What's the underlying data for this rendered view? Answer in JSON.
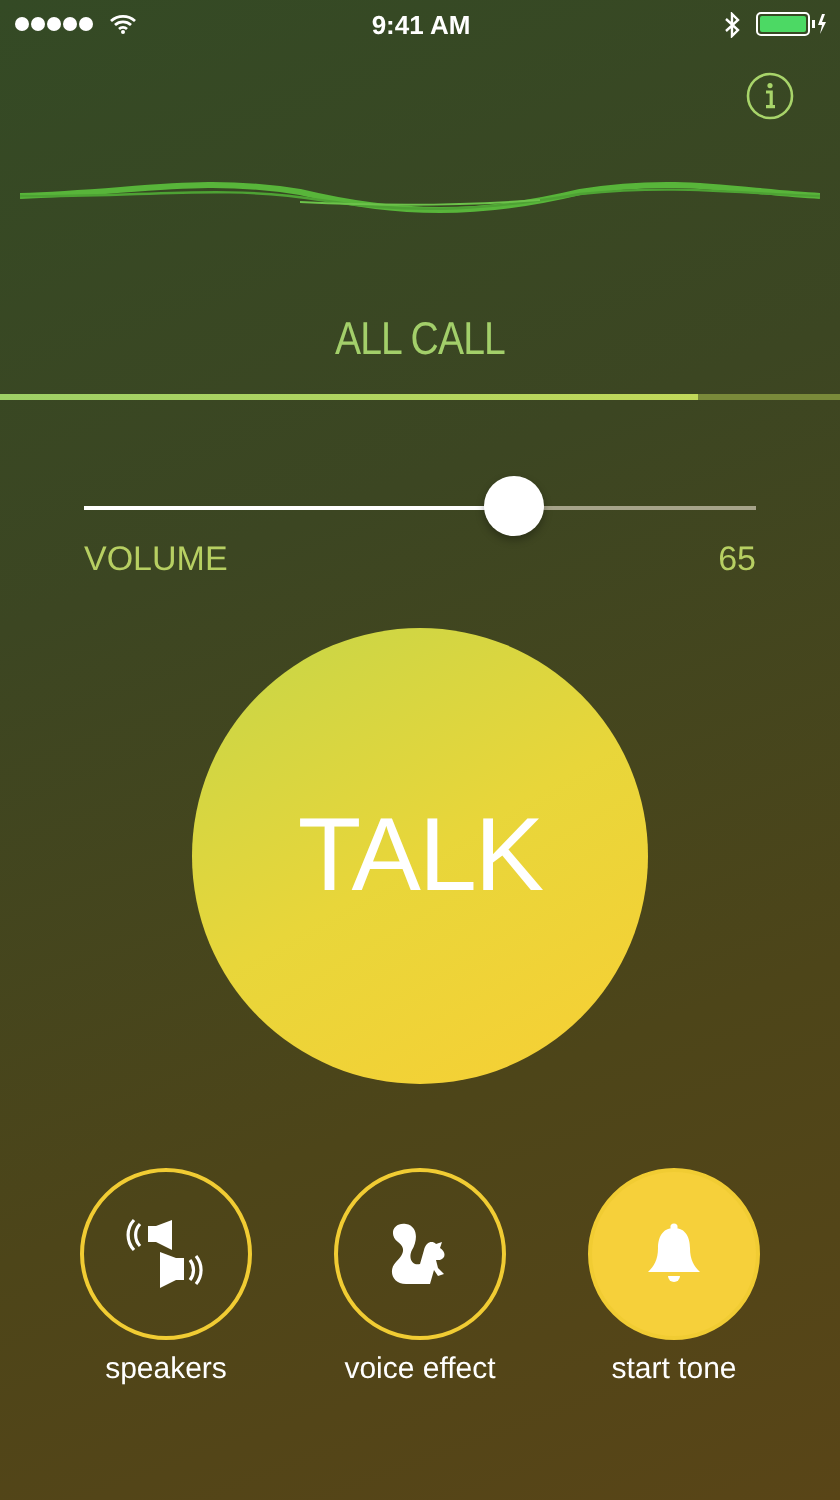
{
  "status_bar": {
    "time": "9:41 AM"
  },
  "channel": {
    "name": "ALL CALL",
    "level": 0.83
  },
  "volume": {
    "label": "VOLUME",
    "value": "65",
    "level": 0.64
  },
  "talk_button": {
    "label": "TALK"
  },
  "actions": [
    {
      "kind": "speakers",
      "label": "speakers",
      "selected": false
    },
    {
      "kind": "squirrel",
      "label": "voice effect",
      "selected": false
    },
    {
      "kind": "bell",
      "label": "start tone",
      "selected": true
    }
  ]
}
